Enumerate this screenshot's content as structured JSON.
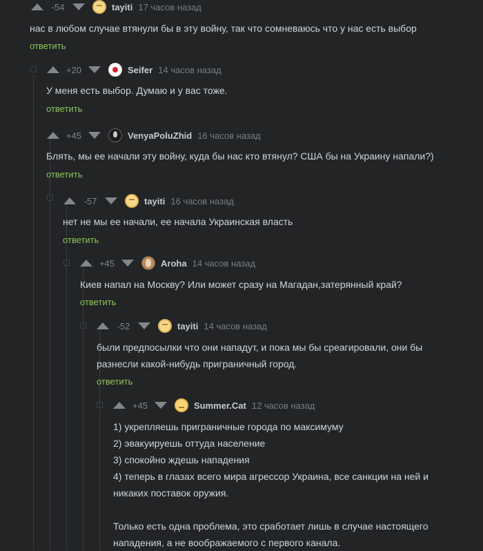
{
  "colors": {
    "background": "#222426",
    "reply_link": "#8ac858",
    "arrow": "#83878b"
  },
  "comments": [
    {
      "rating": "-54",
      "author": "tayiti",
      "avatar": "avatar-tayiti",
      "time": "17 часов назад",
      "lines": [
        "нас в любом случае втянули бы в эту войну, так что сомневаюсь что у нас есть выбор"
      ],
      "reply": "ответить"
    },
    {
      "rating": "+20",
      "author": "Seifer",
      "avatar": "avatar-seifer",
      "time": "14 часов назад",
      "lines": [
        "У меня есть выбор. Думаю и у вас тоже."
      ],
      "reply": "ответить"
    },
    {
      "rating": "+45",
      "author": "VenyaPoluZhid",
      "avatar": "avatar-venya",
      "time": "16 часов назад",
      "lines": [
        "Блять, мы ее начали эту войну, куда бы нас кто втянул? США бы на Украину напали?)"
      ],
      "reply": "ответить"
    },
    {
      "rating": "-57",
      "author": "tayiti",
      "avatar": "avatar-tayiti",
      "time": "16 часов назад",
      "lines": [
        "нет не мы ее начали, ее начала Украинская власть"
      ],
      "reply": "ответить"
    },
    {
      "rating": "+45",
      "author": "Aroha",
      "avatar": "avatar-aroha",
      "time": "14 часов назад",
      "lines": [
        "Киев напал на Москву? Или может сразу на Магадан,затерянный край?"
      ],
      "reply": "ответить"
    },
    {
      "rating": "-52",
      "author": "tayiti",
      "avatar": "avatar-tayiti",
      "time": "14 часов назад",
      "lines": [
        "были предпосылки что они нападут, и пока мы бы среагировали, они бы",
        "разнесли какой-нибудь приграничный город."
      ],
      "reply": "ответить"
    },
    {
      "rating": "+45",
      "author": "Summer.Cat",
      "avatar": "avatar-summer-cat",
      "time": "12 часов назад",
      "lines": [
        "1) укрепляешь приграничные города по максимуму",
        "2) эвакуируешь оттуда население",
        "3) спокойно ждешь нападения",
        "4) теперь в глазах всего мира агрессор Украина, все санкции на ней и",
        "никаких поставок оружия.",
        "",
        "Только есть одна проблема, это сработает лишь в случае настоящего",
        "нападения, а не воображаемого с первого канала."
      ]
    }
  ]
}
